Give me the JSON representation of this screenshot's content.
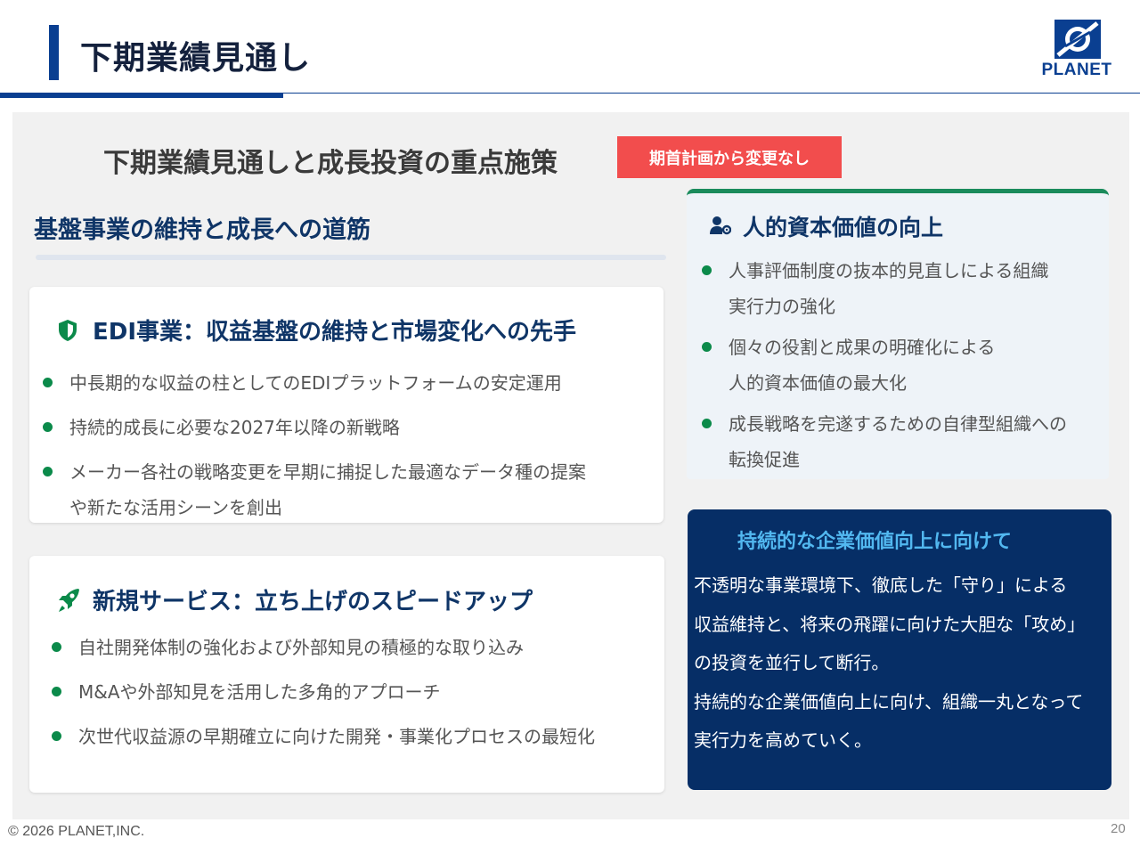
{
  "header": {
    "title": "下期業績見通し",
    "logo_text": "PLANET"
  },
  "main": {
    "heading": "下期業績見通しと成長投資の重点施策",
    "badge": "期首計画から変更なし",
    "section_heading": "基盤事業の維持と成長への道筋"
  },
  "edi_card": {
    "icon": "shield-icon",
    "title": "EDI事業：収益基盤の維持と市場変化への先手",
    "items": [
      {
        "lines": [
          "中長期的な収益の柱としてのEDIプラットフォームの安定運用"
        ]
      },
      {
        "lines": [
          "持続的成長に必要な2027年以降の新戦略"
        ]
      },
      {
        "lines": [
          "メーカー各社の戦略変更を早期に捕捉した最適なデータ種の提案",
          "や新たな活用シーンを創出"
        ]
      }
    ]
  },
  "new_service_card": {
    "icon": "rocket-icon",
    "title": "新規サービス：立ち上げのスピードアップ",
    "items": [
      {
        "lines": [
          "自社開発体制の強化および外部知見の積極的な取り込み"
        ]
      },
      {
        "lines": [
          "M&Aや外部知見を活用した多角的アプローチ"
        ]
      },
      {
        "lines": [
          "次世代収益源の早期確立に向けた開発・事業化プロセスの最短化"
        ]
      }
    ]
  },
  "human_capital_card": {
    "icon": "user-gear-icon",
    "title": "人的資本価値の向上",
    "items": [
      {
        "lines": [
          "人事評価制度の抜本的見直しによる組織",
          "実行力の強化"
        ]
      },
      {
        "lines": [
          "個々の役割と成果の明確化による",
          "人的資本価値の最大化"
        ]
      },
      {
        "lines": [
          "成長戦略を完遂するための自律型組織への",
          "転換促進"
        ]
      }
    ]
  },
  "value_card": {
    "title": "持続的な企業価値向上に向けて",
    "lines": [
      "不透明な事業環境下、徹底した「守り」による",
      "収益維持と、将来の飛躍に向けた大胆な「攻め」",
      "の投資を並行して断行。",
      "持続的な企業価値向上に向け、組織一丸となって",
      "実行力を高めていく。"
    ]
  },
  "colors": {
    "brand_blue": "#0a3f91",
    "navy": "#062e66",
    "heading_navy": "#0f3567",
    "badge_red": "#f24d4d",
    "bullet_green": "#0b8a4a",
    "light_blue_text": "#52b8f0"
  },
  "footer": {
    "copyright": "© 2026 PLANET,INC.",
    "page_number": "20"
  }
}
